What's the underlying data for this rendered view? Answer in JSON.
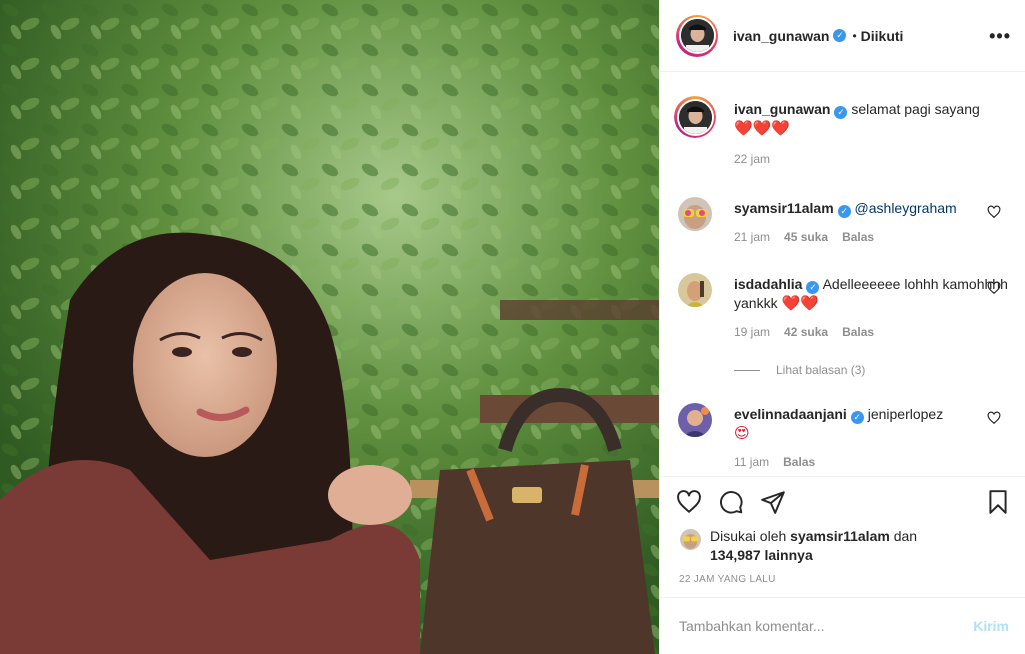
{
  "header": {
    "username": "ivan_gunawan",
    "separator": "•",
    "follow_status": "Diikuti",
    "more_icon": "more-horizontal-icon"
  },
  "caption": {
    "username": "ivan_gunawan",
    "text": "selamat pagi sayang",
    "emoji": "❤️❤️❤️",
    "time": "22 jam"
  },
  "comments": [
    {
      "username": "syamsir11alam",
      "text": "@ashleygraham",
      "emoji": "",
      "time": "21 jam",
      "likes": "45 suka",
      "reply": "Balas"
    },
    {
      "username": "isdadahlia",
      "text": "Adelleeeeee lohhh kamohhhh yankkk",
      "emoji": "❤️❤️",
      "time": "19 jam",
      "likes": "42 suka",
      "reply": "Balas"
    },
    {
      "username": "evelinnadaanjani",
      "text": "jeniperlopez",
      "emoji": "😍",
      "time": "11 jam",
      "likes": "",
      "reply": "Balas"
    }
  ],
  "view_replies": "Lihat balasan (3)",
  "actions": {
    "like_icon": "heart-icon",
    "comment_icon": "comment-icon",
    "share_icon": "send-icon",
    "save_icon": "bookmark-icon"
  },
  "likes": {
    "prefix": "Disukai oleh",
    "user": "syamsir11alam",
    "connector": "dan",
    "count": "134,987 lainnya"
  },
  "post_time": "22 JAM YANG LALU",
  "add_comment": {
    "placeholder": "Tambahkan komentar...",
    "post_label": "Kirim"
  },
  "colors": {
    "verified": "#3897f0",
    "secondary_text": "#8e8e8e",
    "post_button": "#b2dffc",
    "border": "#efefef"
  }
}
